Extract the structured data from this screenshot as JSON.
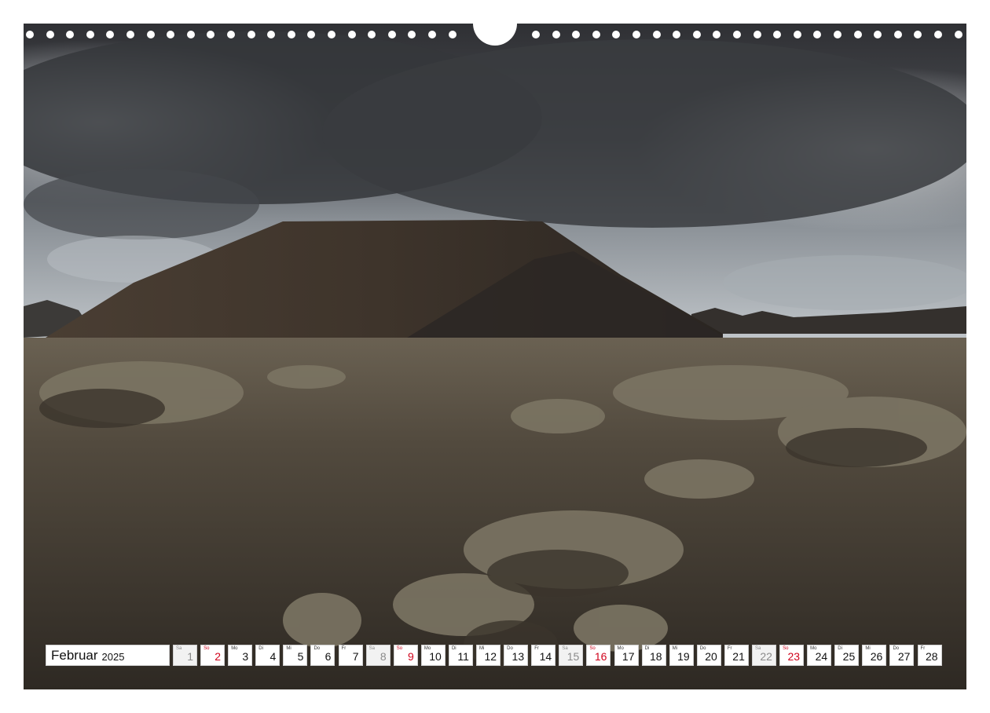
{
  "calendar": {
    "month": "Februar",
    "year": "2025",
    "days": [
      {
        "wd": "Sa",
        "d": "1",
        "type": "sat"
      },
      {
        "wd": "So",
        "d": "2",
        "type": "sun"
      },
      {
        "wd": "Mo",
        "d": "3",
        "type": "wk"
      },
      {
        "wd": "Di",
        "d": "4",
        "type": "wk"
      },
      {
        "wd": "Mi",
        "d": "5",
        "type": "wk"
      },
      {
        "wd": "Do",
        "d": "6",
        "type": "wk"
      },
      {
        "wd": "Fr",
        "d": "7",
        "type": "wk"
      },
      {
        "wd": "Sa",
        "d": "8",
        "type": "sat"
      },
      {
        "wd": "So",
        "d": "9",
        "type": "sun"
      },
      {
        "wd": "Mo",
        "d": "10",
        "type": "wk"
      },
      {
        "wd": "Di",
        "d": "11",
        "type": "wk"
      },
      {
        "wd": "Mi",
        "d": "12",
        "type": "wk"
      },
      {
        "wd": "Do",
        "d": "13",
        "type": "wk"
      },
      {
        "wd": "Fr",
        "d": "14",
        "type": "wk"
      },
      {
        "wd": "Sa",
        "d": "15",
        "type": "sat"
      },
      {
        "wd": "So",
        "d": "16",
        "type": "sun"
      },
      {
        "wd": "Mo",
        "d": "17",
        "type": "wk"
      },
      {
        "wd": "Di",
        "d": "18",
        "type": "wk"
      },
      {
        "wd": "Mi",
        "d": "19",
        "type": "wk"
      },
      {
        "wd": "Do",
        "d": "20",
        "type": "wk"
      },
      {
        "wd": "Fr",
        "d": "21",
        "type": "wk"
      },
      {
        "wd": "Sa",
        "d": "22",
        "type": "sat"
      },
      {
        "wd": "So",
        "d": "23",
        "type": "sun"
      },
      {
        "wd": "Mo",
        "d": "24",
        "type": "wk"
      },
      {
        "wd": "Di",
        "d": "25",
        "type": "wk"
      },
      {
        "wd": "Mi",
        "d": "26",
        "type": "wk"
      },
      {
        "wd": "Do",
        "d": "27",
        "type": "wk"
      },
      {
        "wd": "Fr",
        "d": "28",
        "type": "wk"
      }
    ]
  },
  "colors": {
    "sunday": "#d0021b",
    "saturday_bg": "#f2f2f2",
    "sky_dark": "#3c3e42",
    "ground": "#4a4237"
  },
  "scene": {
    "photo": "volcanic-landscape-lanzarote",
    "binding": "wire-binding-holes"
  }
}
